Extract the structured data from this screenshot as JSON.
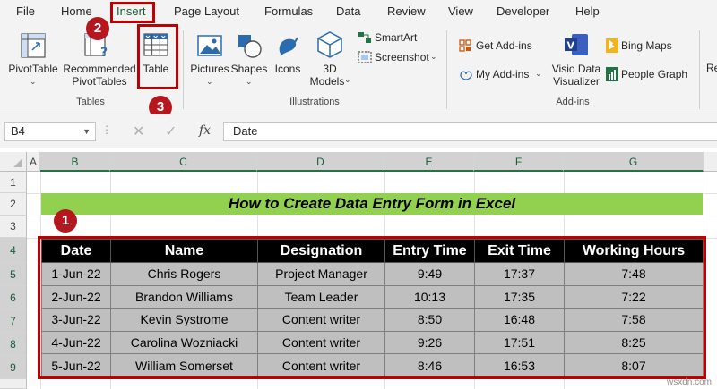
{
  "menu": {
    "tabs": [
      "File",
      "Home",
      "Insert",
      "Page Layout",
      "Formulas",
      "Data",
      "Review",
      "View",
      "Developer",
      "Help"
    ],
    "active": "Insert"
  },
  "ribbon": {
    "pivottable": "PivotTable",
    "recommended": "Recommended",
    "pivottables": "PivotTables",
    "table": "Table",
    "tables_group": "Tables",
    "pictures": "Pictures",
    "shapes": "Shapes",
    "icons": "Icons",
    "models_3d_line1": "3D",
    "models_3d_line2": "Models",
    "smartart": "SmartArt",
    "screenshot": "Screenshot",
    "illustrations_group": "Illustrations",
    "get_addins": "Get Add-ins",
    "my_addins": "My Add-ins",
    "visio_line1": "Visio Data",
    "visio_line2": "Visualizer",
    "bing_maps": "Bing Maps",
    "people_graph": "People Graph",
    "addins_group": "Add-ins",
    "cut_off": "Re"
  },
  "callouts": [
    "1",
    "2",
    "3"
  ],
  "formula_bar": {
    "name_box": "B4",
    "fx": "fx",
    "value": "Date"
  },
  "columns": [
    "A",
    "B",
    "C",
    "D",
    "E",
    "F",
    "G"
  ],
  "rows": [
    "1",
    "2",
    "3",
    "4",
    "5",
    "6",
    "7",
    "8",
    "9"
  ],
  "sheet": {
    "title": "How to Create Data Entry Form in Excel",
    "headers": [
      "Date",
      "Name",
      "Designation",
      "Entry Time",
      "Exit Time",
      "Working Hours"
    ],
    "data": [
      [
        "1-Jun-22",
        "Chris Rogers",
        "Project Manager",
        "9:49",
        "17:37",
        "7:48"
      ],
      [
        "2-Jun-22",
        "Brandon Williams",
        "Team Leader",
        "10:13",
        "17:35",
        "7:22"
      ],
      [
        "3-Jun-22",
        "Kevin Systrome",
        "Content writer",
        "8:50",
        "16:48",
        "7:58"
      ],
      [
        "4-Jun-22",
        "Carolina Wozniacki",
        "Content writer",
        "9:26",
        "17:51",
        "8:25"
      ],
      [
        "5-Jun-22",
        "William Somerset",
        "Content writer",
        "8:46",
        "16:53",
        "8:07"
      ]
    ]
  },
  "watermark": "wsxdn.com",
  "colors": {
    "accent": "#217346",
    "highlight": "#c00000",
    "title_fill": "#92d050",
    "header_fill": "#000000",
    "cell_fill": "#bfbfbf"
  }
}
